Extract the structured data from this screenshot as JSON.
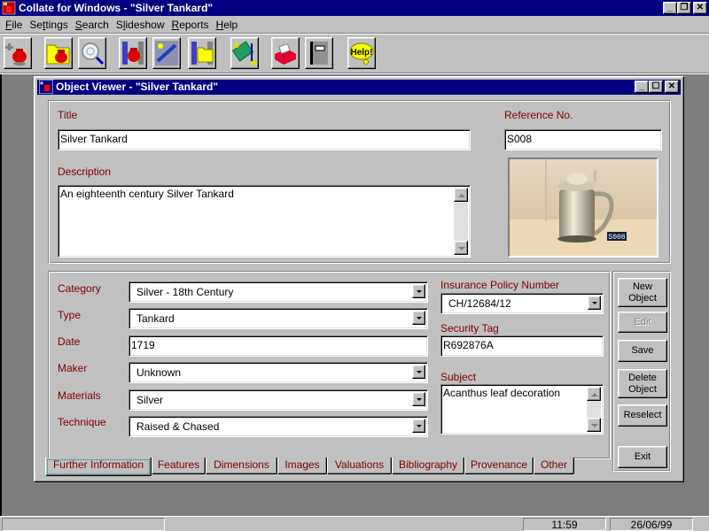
{
  "app": {
    "title": "Collate for Windows - \"Silver Tankard\"",
    "caption_buttons": [
      "minimize-icon",
      "restore-icon",
      "close-icon"
    ]
  },
  "menu": [
    {
      "label": "File",
      "accel": "F",
      "rest": "ile"
    },
    {
      "label": "Settings",
      "pre": "Se",
      "accel": "t",
      "rest": "tings"
    },
    {
      "label": "Search",
      "accel": "S",
      "rest": "earch"
    },
    {
      "label": "Slideshow",
      "pre": "S",
      "accel": "l",
      "rest": "ideshow"
    },
    {
      "label": "Reports",
      "accel": "R",
      "rest": "eports"
    },
    {
      "label": "Help",
      "accel": "H",
      "rest": "elp"
    }
  ],
  "toolbar": [
    {
      "icon": "new-object-icon"
    },
    {
      "icon": "open-collection-icon"
    },
    {
      "icon": "search-icon"
    },
    {
      "icon": "slideshow-object-icon"
    },
    {
      "icon": "tools-icon"
    },
    {
      "icon": "slideshow-folder-icon"
    },
    {
      "icon": "valuations-icon"
    },
    {
      "icon": "card-index-icon"
    },
    {
      "icon": "notebook-icon"
    },
    {
      "icon": "help-icon",
      "label": "Help!"
    }
  ],
  "viewer": {
    "title": "Object Viewer - \"Silver Tankard\"",
    "fields": {
      "title": {
        "label": "Title",
        "value": "Silver Tankard"
      },
      "reference": {
        "label": "Reference No.",
        "value": "S008"
      },
      "description": {
        "label": "Description",
        "value": "An eighteenth century Silver Tankard"
      },
      "category": {
        "label": "Category",
        "value": "Silver - 18th Century"
      },
      "type": {
        "label": "Type",
        "value": "Tankard"
      },
      "date": {
        "label": "Date",
        "value": "1719"
      },
      "maker": {
        "label": "Maker",
        "value": "Unknown"
      },
      "materials": {
        "label": "Materials",
        "value": "Silver"
      },
      "technique": {
        "label": "Technique",
        "value": "Raised & Chased"
      },
      "insurance": {
        "label": "Insurance Policy Number",
        "value": "CH/12684/12"
      },
      "security": {
        "label": "Security Tag",
        "value": "R692876A"
      },
      "subject": {
        "label": "Subject",
        "value": "Acanthus leaf decoration"
      }
    },
    "photo": {
      "caption": "S008",
      "alt": "Silver tankard photograph"
    },
    "buttons": {
      "new_object": "New Object",
      "edit": "Edit",
      "save": "Save",
      "delete_object": "Delete Object",
      "reselect": "Reselect",
      "exit": "Exit"
    },
    "tabs": [
      {
        "label": "Further Information",
        "active": true
      },
      {
        "label": "Features"
      },
      {
        "label": "Dimensions"
      },
      {
        "label": "Images"
      },
      {
        "label": "Valuations"
      },
      {
        "label": "Bibliography"
      },
      {
        "label": "Provenance"
      },
      {
        "label": "Other"
      }
    ]
  },
  "status": {
    "message": "",
    "time": "11:59",
    "date": "26/06/99"
  },
  "colors": {
    "titlebar": "#000080",
    "face": "#c0c0c0",
    "label": "#800000",
    "desktop": "#808080"
  }
}
